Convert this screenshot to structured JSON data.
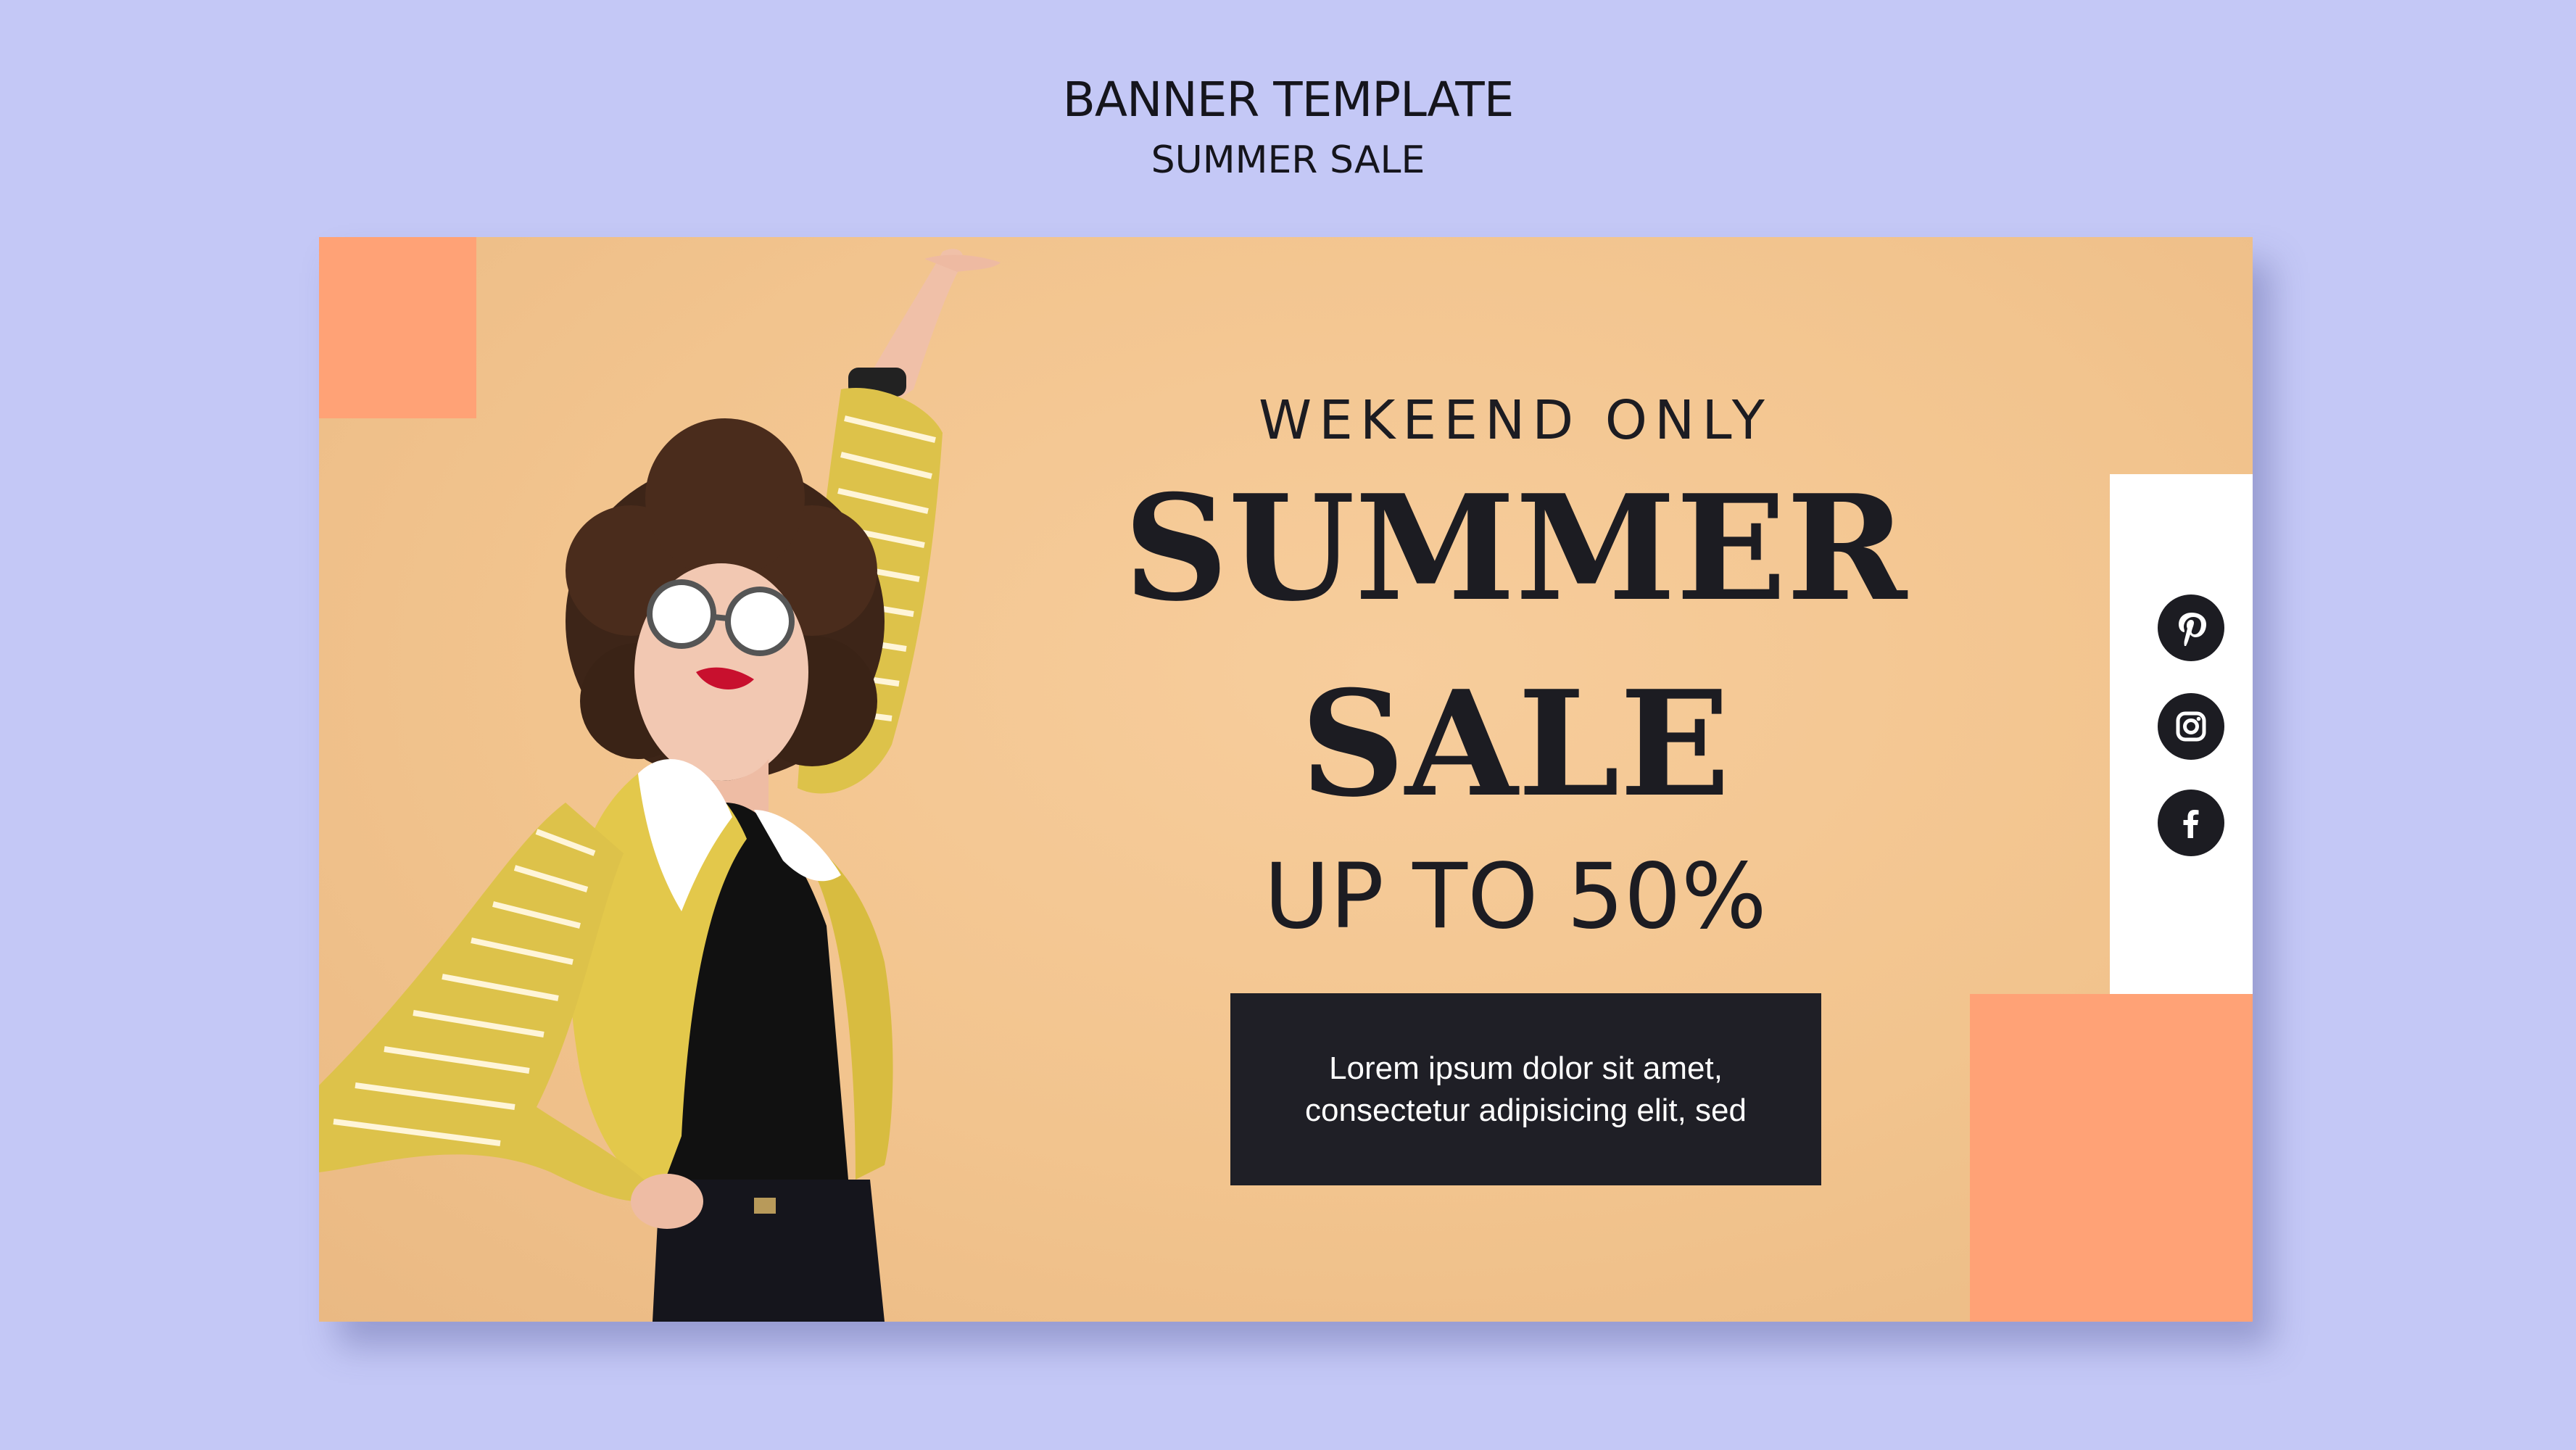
{
  "header": {
    "title": "BANNER TEMPLATE",
    "subtitle": "SUMMER SALE"
  },
  "banner": {
    "kicker": "WEKEEND ONLY",
    "headline_line1": "SUMMER",
    "headline_line2": "SALE",
    "discount": "UP TO 50%",
    "cta_text": {
      "line1": "Lorem ipsum dolor sit amet,",
      "line2": "consectetur adipisicing elit, sed"
    },
    "social_icons": [
      "pinterest-icon",
      "instagram-icon",
      "facebook-icon"
    ]
  },
  "colors": {
    "page_background": "#c4c8f6",
    "banner_background": "#f2c48e",
    "accent": "#ffa276",
    "dark": "#1f1f26",
    "jacket": "#e2c84a"
  }
}
